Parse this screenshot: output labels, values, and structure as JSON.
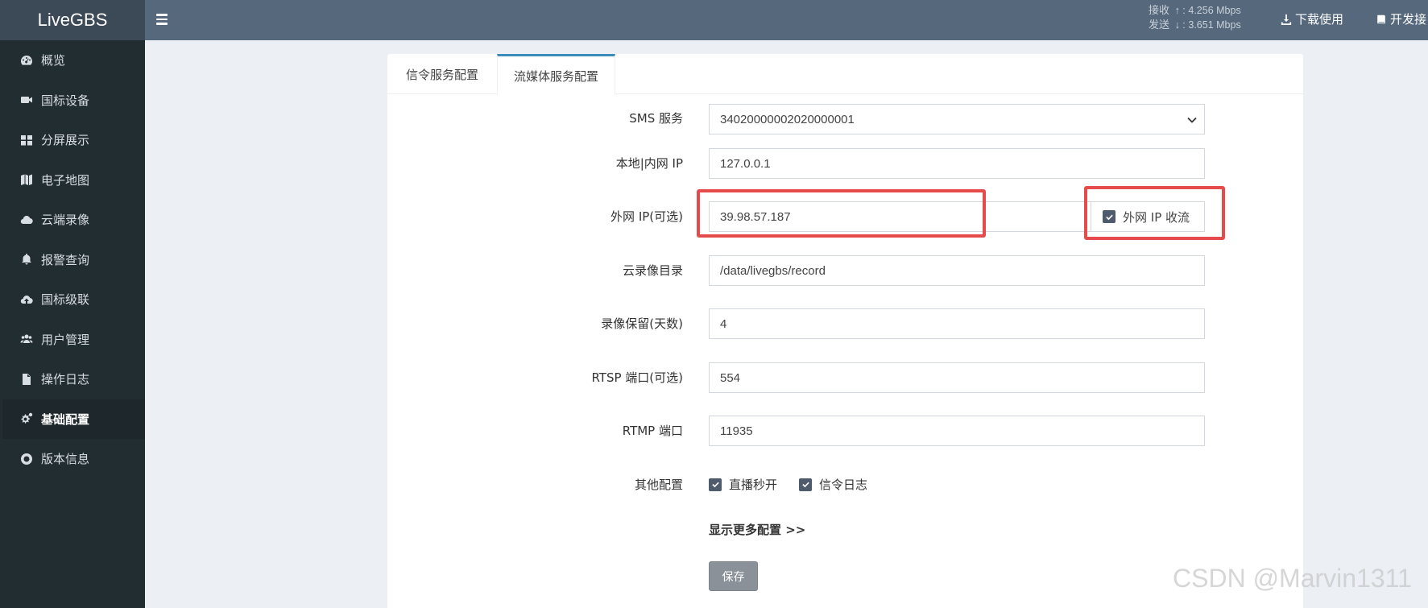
{
  "app": {
    "title": "LiveGBS"
  },
  "sidebar": {
    "items": [
      {
        "label": "概览",
        "icon": "dashboard-icon"
      },
      {
        "label": "国标设备",
        "icon": "video-camera-icon"
      },
      {
        "label": "分屏展示",
        "icon": "grid-icon"
      },
      {
        "label": "电子地图",
        "icon": "map-icon"
      },
      {
        "label": "云端录像",
        "icon": "cloud-icon"
      },
      {
        "label": "报警查询",
        "icon": "bell-icon"
      },
      {
        "label": "国标级联",
        "icon": "cloud-upload-icon"
      },
      {
        "label": "用户管理",
        "icon": "users-icon"
      },
      {
        "label": "操作日志",
        "icon": "file-icon"
      },
      {
        "label": "基础配置",
        "icon": "gears-icon",
        "active": true
      },
      {
        "label": "版本信息",
        "icon": "life-ring-icon"
      }
    ]
  },
  "header": {
    "receive_label": "接收",
    "receive_arrow": "↑",
    "receive_value": "4.256 Mbps",
    "send_label": "发送",
    "send_arrow": "↓",
    "send_value": "3.651 Mbps",
    "download_label": "下载使用",
    "dev_label": "开发接"
  },
  "tabs": [
    {
      "label": "信令服务配置",
      "active": false
    },
    {
      "label": "流媒体服务配置",
      "active": true
    }
  ],
  "form": {
    "sms_label": "SMS 服务",
    "sms_value": "34020000002020000001",
    "local_ip_label": "本地|内网 IP",
    "local_ip_value": "127.0.0.1",
    "ext_ip_label": "外网 IP(可选)",
    "ext_ip_value": "39.98.57.187",
    "ext_ip_stream_label": "外网 IP 收流",
    "ext_ip_stream_checked": true,
    "record_dir_label": "云录像目录",
    "record_dir_value": "/data/livegbs/record",
    "record_keep_label": "录像保留(天数)",
    "record_keep_value": "4",
    "rtsp_label": "RTSP 端口(可选)",
    "rtsp_value": "554",
    "rtmp_label": "RTMP 端口",
    "rtmp_value": "11935",
    "other_label": "其他配置",
    "option_live_fast": "直播秒开",
    "option_signal_log": "信令日志",
    "more_label": "显示更多配置 >>",
    "save_label": "保存"
  },
  "watermark": "CSDN @Marvin1311",
  "colors": {
    "sidebar_bg": "#222d32",
    "header_bg": "#56687c",
    "highlight_red": "#e54b4b",
    "checkbox": "#4d5b6c"
  }
}
